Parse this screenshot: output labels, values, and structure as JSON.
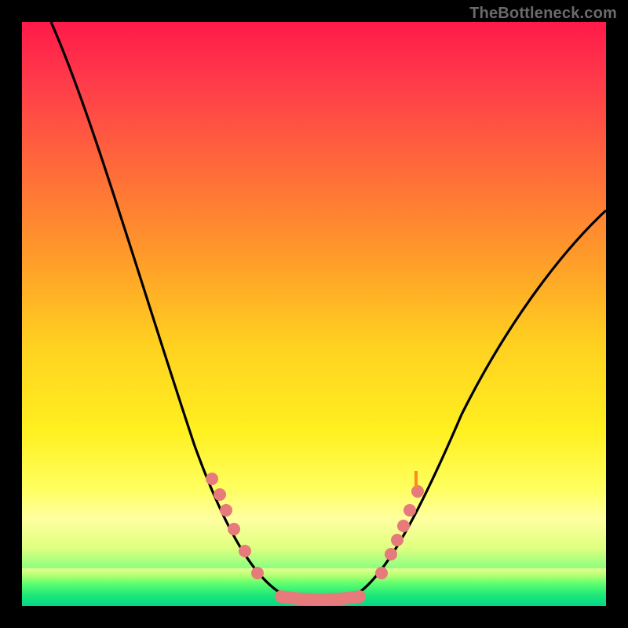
{
  "watermark": "TheBottleneck.com",
  "chart_data": {
    "type": "line",
    "title": "",
    "xlabel": "",
    "ylabel": "",
    "xlim": [
      0,
      100
    ],
    "ylim": [
      0,
      100
    ],
    "series": [
      {
        "name": "curve",
        "x": [
          5,
          10,
          15,
          20,
          25,
          30,
          35,
          40,
          45,
          48,
          50,
          52,
          55,
          60,
          65,
          70,
          75,
          80,
          85,
          90,
          95,
          100
        ],
        "values": [
          100,
          90,
          80,
          69,
          57,
          44,
          31,
          19,
          7,
          2,
          0,
          0,
          2,
          8,
          16,
          25,
          33,
          41,
          48,
          55,
          61,
          67
        ]
      }
    ],
    "markers_left": {
      "x": [
        30,
        32,
        33,
        34,
        36,
        38
      ],
      "y": [
        24,
        21,
        19,
        17,
        14,
        10
      ]
    },
    "markers_right": {
      "x": [
        58,
        60,
        61,
        62,
        63,
        65
      ],
      "y": [
        10,
        14,
        16,
        18,
        20,
        23
      ]
    },
    "flat_segment": {
      "x": [
        44,
        46,
        48,
        50,
        52,
        54,
        56
      ],
      "y": [
        1,
        1,
        0.5,
        0.5,
        0.5,
        1,
        1
      ]
    }
  }
}
